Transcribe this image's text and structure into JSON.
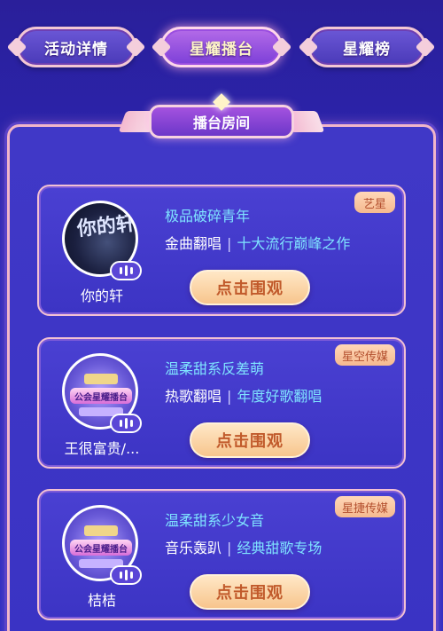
{
  "tabs": [
    {
      "label": "活动详情",
      "active": false
    },
    {
      "label": "星耀播台",
      "active": true
    },
    {
      "label": "星耀榜",
      "active": false
    }
  ],
  "panel": {
    "title": "播台房间"
  },
  "rooms": [
    {
      "tag": "艺星",
      "avatar_text": "你的轩",
      "name": "你的轩",
      "headline": "极品破碎青年",
      "category": "金曲翻唱",
      "separator": "|",
      "slogan": "十大流行巅峰之作",
      "button": "点击围观"
    },
    {
      "tag": "星空传媒",
      "avatar_text": "公会星耀播台",
      "name": "王很富贵/...",
      "headline": "温柔甜系反差萌",
      "category": "热歌翻唱",
      "separator": "|",
      "slogan": "年度好歌翻唱",
      "button": "点击围观"
    },
    {
      "tag": "星捷传媒",
      "avatar_text": "公会星耀播台",
      "name": "桔桔",
      "headline": "温柔甜系少女音",
      "category": "音乐轰趴",
      "separator": "|",
      "slogan": "经典甜歌专场",
      "button": "点击围观"
    }
  ],
  "colors": {
    "background": "#2c27b8",
    "accent_cyan": "#7fe3ff",
    "button_text": "#c15a2b",
    "tag_text": "#b34f2e"
  }
}
